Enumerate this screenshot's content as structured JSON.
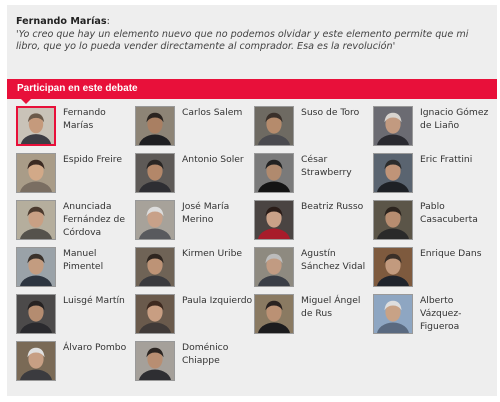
{
  "quote": {
    "author": "Fernando Marías",
    "colon": ":",
    "text": "'Yo creo que hay un elemento nuevo que no podemos olvidar y este elemento permite que mi libro, que yo lo pueda vender directamente al comprador. Esa es la revolución'"
  },
  "debate": {
    "title": "Participan en este debate",
    "accent_color": "#e8103a"
  },
  "participants": [
    {
      "name": "Fernando Marías",
      "selected": true,
      "bg": "#c9c3b8",
      "skin": "#c59a7c",
      "hair": "#6b5a4a",
      "shirt": "#3d3d44"
    },
    {
      "name": "Carlos Salem",
      "bg": "#8d8476",
      "skin": "#a97f62",
      "hair": "#2b2420",
      "shirt": "#1f1f22"
    },
    {
      "name": "Suso de Toro",
      "bg": "#6e6a62",
      "skin": "#b58b6c",
      "hair": "#3a302a",
      "shirt": "#4a4a4f"
    },
    {
      "name": "Ignacio Gómez de Liaño",
      "bg": "#6b6b72",
      "skin": "#c29a80",
      "hair": "#d8d4cf",
      "shirt": "#2a2a30"
    },
    {
      "name": "Espido Freire",
      "bg": "#a99c88",
      "skin": "#d2a988",
      "hair": "#3b2a22",
      "shirt": "#7a6e62"
    },
    {
      "name": "Antonio Soler",
      "bg": "#5e5a57",
      "skin": "#b38769",
      "hair": "#2a2624",
      "shirt": "#2e2e33"
    },
    {
      "name": "César Strawberry",
      "bg": "#7a7a7a",
      "skin": "#b08a6e",
      "hair": "#222222",
      "shirt": "#141414"
    },
    {
      "name": "Eric Frattini",
      "bg": "#5a6470",
      "skin": "#c09478",
      "hair": "#2c2c2c",
      "shirt": "#1e2126"
    },
    {
      "name": "Anunciada Fernández de Córdova",
      "bg": "#b5ae9d",
      "skin": "#c9a084",
      "hair": "#4b3a2e",
      "shirt": "#55524c"
    },
    {
      "name": "José María Merino",
      "bg": "#a7a29a",
      "skin": "#c8a189",
      "hair": "#dcdcdc",
      "shirt": "#595a5e"
    },
    {
      "name": "Beatriz Russo",
      "bg": "#4a4442",
      "skin": "#caa188",
      "hair": "#2a1c18",
      "shirt": "#a81c2b"
    },
    {
      "name": "Pablo Casacuberta",
      "bg": "#5b5548",
      "skin": "#b78d70",
      "hair": "#2c241e",
      "shirt": "#2a2a2a"
    },
    {
      "name": "Manuel Pimentel",
      "bg": "#9aa2a8",
      "skin": "#c39c80",
      "hair": "#3a322c",
      "shirt": "#2d3540"
    },
    {
      "name": "Kirmen Uribe",
      "bg": "#6f6356",
      "skin": "#bd9376",
      "hair": "#2f2620",
      "shirt": "#3a3a3e"
    },
    {
      "name": "Agustín Sánchez Vidal",
      "bg": "#8e8a80",
      "skin": "#c19b82",
      "hair": "#bcbcbc",
      "shirt": "#3a3e46"
    },
    {
      "name": "Enrique Dans",
      "bg": "#7e5a3e",
      "skin": "#c29a7e",
      "hair": "#3a2f28",
      "shirt": "#20242c"
    },
    {
      "name": "Luisgé Martín",
      "bg": "#4c4a4a",
      "skin": "#b48c70",
      "hair": "#262222",
      "shirt": "#2a2a2e"
    },
    {
      "name": "Paula Izquierdo",
      "bg": "#6a5a4c",
      "skin": "#c89e82",
      "hair": "#3e2a20",
      "shirt": "#403a38"
    },
    {
      "name": "Miguel Ángel de Rus",
      "bg": "#8a7a62",
      "skin": "#bb9174",
      "hair": "#2a2220",
      "shirt": "#1c1c1e"
    },
    {
      "name": "Alberto Vázquez-Figueroa",
      "bg": "#8ea6c2",
      "skin": "#c8a286",
      "hair": "#dedede",
      "shirt": "#5a6a80"
    },
    {
      "name": "Álvaro Pombo",
      "bg": "#7a6a56",
      "skin": "#c79f84",
      "hair": "#e0e0e0",
      "shirt": "#3b3b3f"
    },
    {
      "name": "Doménico Chiappe",
      "bg": "#a5a09a",
      "skin": "#b88e72",
      "hair": "#2b2522",
      "shirt": "#2e2e32"
    }
  ]
}
